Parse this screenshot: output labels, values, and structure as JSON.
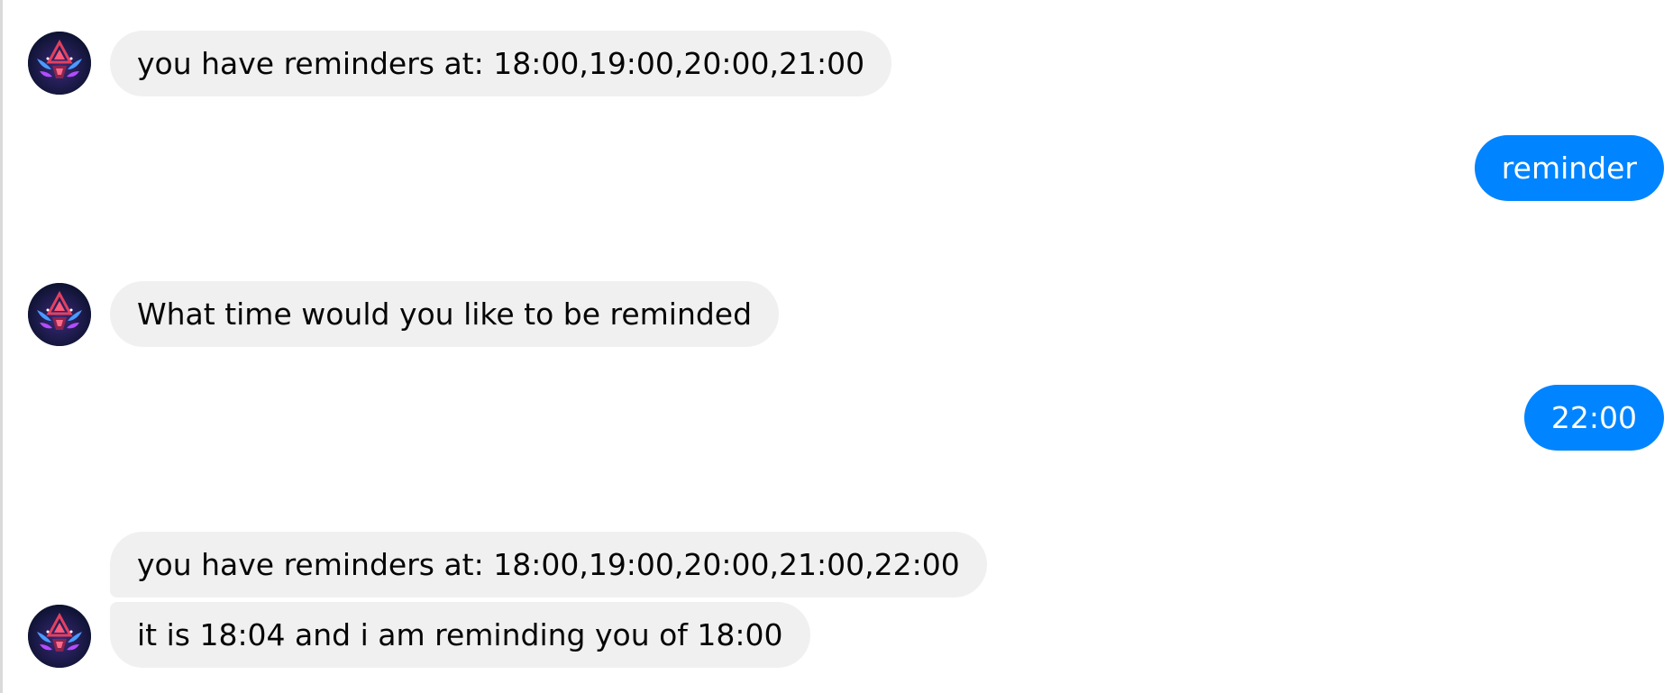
{
  "conversation": {
    "messages": [
      {
        "sender": "bot",
        "text": "you have reminders at: 18:00,19:00,20:00,21:00"
      },
      {
        "sender": "user",
        "text": "reminder"
      },
      {
        "sender": "bot",
        "text": "What time would you like to be reminded"
      },
      {
        "sender": "user",
        "text": "22:00"
      },
      {
        "sender": "bot",
        "text": "you have reminders at: 18:00,19:00,20:00,21:00,22:00"
      },
      {
        "sender": "bot",
        "text": "it is 18:04 and i am reminding you of 18:00"
      }
    ]
  },
  "colors": {
    "incoming_bubble": "#f0f0f0",
    "incoming_text": "#050505",
    "outgoing_bubble": "#0084ff",
    "outgoing_text": "#ffffff"
  },
  "icons": {
    "avatar": "bot-avatar-icon"
  }
}
